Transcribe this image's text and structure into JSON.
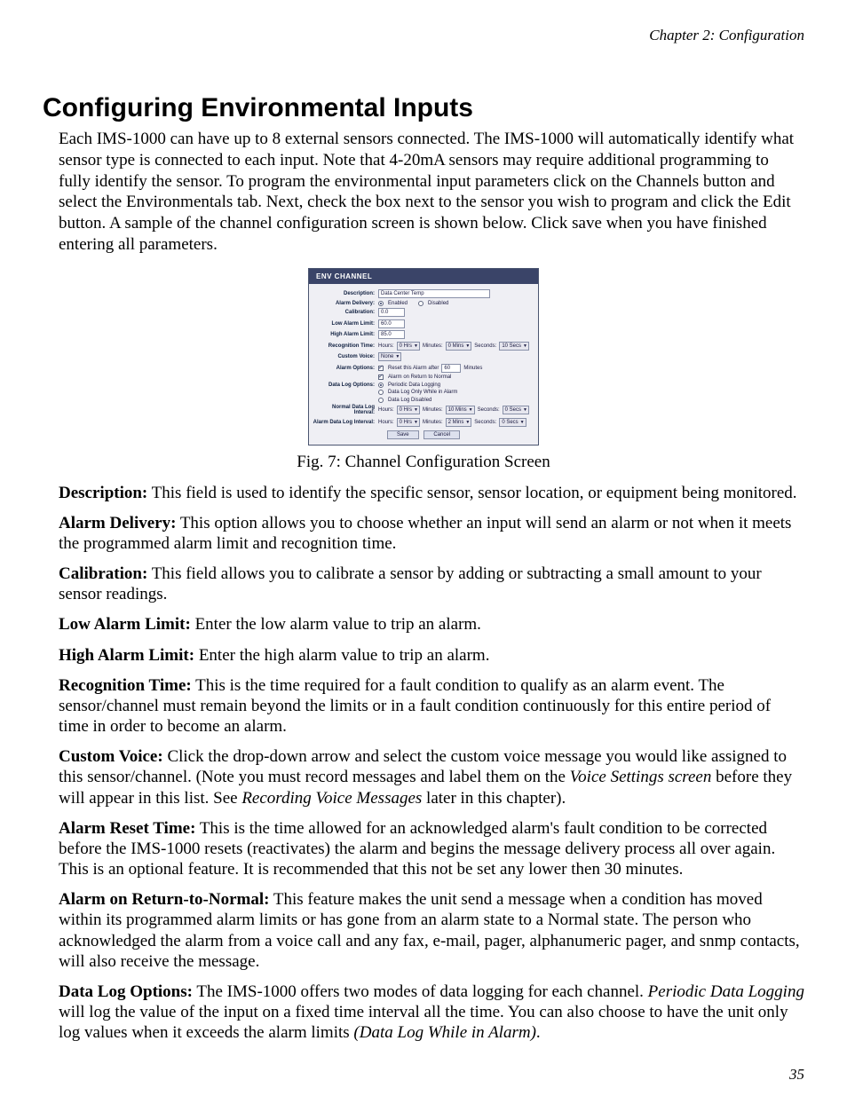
{
  "chapter": "Chapter 2: Configuration",
  "heading": "Configuring Environmental Inputs",
  "intro": "Each IMS-1000 can have up to 8 external sensors connected. The IMS-1000 will automatically identify what sensor type is connected to each input. Note that 4-20mA sensors may require additional programming to fully identify the sensor. To program the environmental input parameters click on the Channels button and select the Environmentals tab. Next, check the box next to the sensor you wish to program and click the Edit button. A sample of the channel configuration screen is shown below. Click save when you have finished entering all parameters.",
  "figure_caption": "Fig. 7: Channel Configuration Screen",
  "page_number": "35",
  "screenshot": {
    "title": "ENV CHANNEL",
    "labels": {
      "description": "Description:",
      "alarm_delivery": "Alarm Delivery:",
      "calibration": "Calibration:",
      "low_limit": "Low Alarm Limit:",
      "high_limit": "High Alarm Limit:",
      "recog_time": "Recognition Time:",
      "custom_voice": "Custom Voice:",
      "alarm_options": "Alarm Options:",
      "datalog_options": "Data Log Options:",
      "normal_interval": "Normal Data Log Interval:",
      "alarm_interval": "Alarm Data Log Interval:",
      "hours": "Hours:",
      "minutes": "Minutes:",
      "seconds": "Seconds:"
    },
    "values": {
      "description": "Data Center Temp",
      "enabled": "Enabled",
      "disabled": "Disabled",
      "calibration": "0.0",
      "low_limit": "60.0",
      "high_limit": "85.0",
      "recog_hours": "0 Hrs",
      "recog_minutes": "0 Mins",
      "recog_seconds": "10 Secs",
      "custom_voice": "None",
      "reset_prefix": "Reset this Alarm after",
      "reset_value": "60",
      "reset_suffix": "Minutes",
      "return_normal": "Alarm on Return to Normal",
      "periodic": "Periodic Data Logging",
      "only_alarm": "Data Log Only While in Alarm",
      "log_disabled": "Data Log Disabled",
      "n_hours": "0 Hrs",
      "n_minutes": "10 Mins",
      "n_seconds": "0 Secs",
      "a_hours": "0 Hrs",
      "a_minutes": "2 Mins",
      "a_seconds": "0 Secs",
      "save": "Save",
      "cancel": "Cancel"
    }
  },
  "definitions": {
    "description": {
      "label": "Description:",
      "text": " This field is used to identify the specific sensor, sensor location, or equipment being monitored."
    },
    "alarm_delivery": {
      "label": "Alarm Delivery:",
      "text": " This option allows you to choose whether an input will send an alarm or not when it meets the programmed alarm limit and recognition time."
    },
    "calibration": {
      "label": "Calibration:",
      "text": " This field allows you to calibrate a sensor by adding or subtracting a small amount to your sensor readings."
    },
    "low_limit": {
      "label": "Low Alarm Limit:",
      "text": " Enter the low alarm value to trip an alarm."
    },
    "high_limit": {
      "label": "High Alarm Limit:",
      "text": " Enter the high alarm value to trip an alarm."
    },
    "recog_time": {
      "label": "Recognition Time:",
      "text": " This is the time required for a fault condition to qualify as an alarm event. The sensor/channel must remain beyond the limits or in a fault condition continuously for this entire period of time in order to become an alarm."
    },
    "custom_voice": {
      "label": "Custom Voice:",
      "text1": " Click the drop-down arrow and select the custom voice message you would like assigned to this sensor/channel. (Note you must record messages and label them on the ",
      "ital1": "Voice Settings screen",
      "text2": " before they will appear in this list. See ",
      "ital2": "Recording Voice Messages",
      "text3": " later in this chapter)."
    },
    "alarm_reset": {
      "label": "Alarm Reset Time:",
      "text": " This is the time allowed for an acknowledged alarm's fault condition to be corrected before the IMS-1000 resets (reactivates) the alarm and begins the message delivery process all over again. This is an optional feature. It is recommended that this not be set any lower then 30 minutes."
    },
    "return_normal": {
      "label": "Alarm on Return-to-Normal:",
      "text": " This feature makes the unit send a message when a condition has moved within its programmed alarm limits or has gone from an alarm state to a Normal state. The person who acknowledged the alarm from a voice call and any fax, e-mail, pager, alphanumeric pager, and snmp contacts, will also receive the message."
    },
    "data_log": {
      "label": "Data Log Options:",
      "text1": " The IMS-1000 offers two modes of data logging for each channel. ",
      "ital1": "Periodic Data Logging",
      "text2": " will log the value of the input on a fixed time interval all the time. You can also choose to have the unit only log values when it exceeds the alarm limits ",
      "ital2": "(Data Log While in Alarm)",
      "text3": "."
    }
  }
}
